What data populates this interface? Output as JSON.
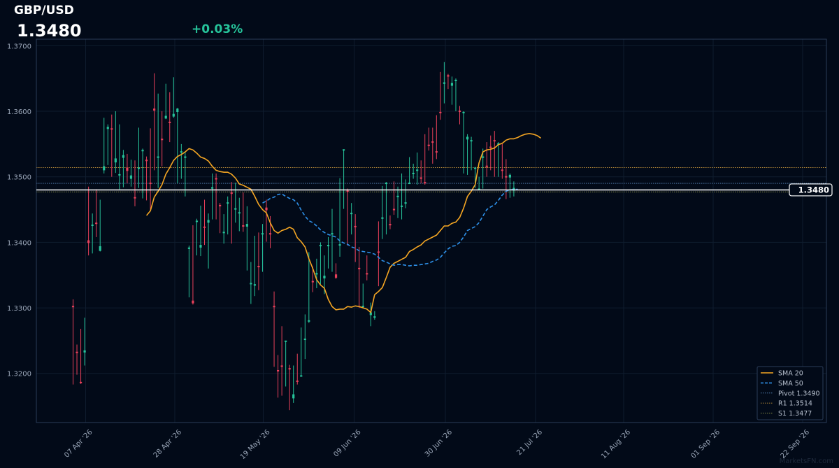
{
  "header": {
    "symbol": "GBP/USD",
    "price": "1.3480",
    "change": "+0.03%"
  },
  "watermark": "MarketsFN.com",
  "colors": {
    "background": "#020a18",
    "up": "#26c39a",
    "down": "#e8405a",
    "sma20": "#f5a623",
    "sma50": "#2e90e8",
    "pivot": "#5a8ac0",
    "r1": "#c9963a",
    "s1": "#9aa04a",
    "last_price_line": "#ffffff"
  },
  "chart_data": {
    "type": "candlestick",
    "title": "GBP/USD",
    "ylim": [
      1.3125,
      1.371
    ],
    "y_ticks": [
      "1.3200",
      "1.3300",
      "1.3400",
      "1.3500",
      "1.3600",
      "1.3700"
    ],
    "x_ticks": [
      "07 Apr '26",
      "28 Apr '26",
      "19 May '26",
      "09 Jun '26",
      "30 Jun '26",
      "21 Jul '26",
      "11 Aug '26",
      "01 Sep '26",
      "22 Sep '26"
    ],
    "last_price_label": "1.3480",
    "last_price": 1.348,
    "grid": true,
    "legend_position": "bottom-right",
    "legend": [
      "SMA 20",
      "SMA 50",
      "Pivot 1.3490",
      "R1 1.3514",
      "S1 1.3477"
    ],
    "levels": {
      "pivot": 1.349,
      "r1": 1.3514,
      "s1": 1.3477
    },
    "candles": [
      [
        1.3302,
        1.3302,
        1.3313,
        1.3183,
        "down"
      ],
      [
        1.3232,
        1.3232,
        1.3244,
        1.3198,
        "down"
      ],
      [
        1.3186,
        1.3186,
        1.3268,
        1.3184,
        "down"
      ],
      [
        1.3233,
        1.3234,
        1.3285,
        1.3212,
        "up"
      ],
      [
        1.3402,
        1.34,
        1.3485,
        1.338,
        "down"
      ],
      [
        1.3426,
        1.3426,
        1.3444,
        1.3383,
        "up"
      ],
      [
        1.3429,
        1.3429,
        1.3481,
        1.3408,
        "down"
      ],
      [
        1.3388,
        1.3393,
        1.3465,
        1.3386,
        "up"
      ],
      [
        1.3511,
        1.3515,
        1.359,
        1.3505,
        "up"
      ],
      [
        1.3574,
        1.3575,
        1.358,
        1.3518,
        "up"
      ],
      [
        1.3573,
        1.3573,
        1.3595,
        1.35,
        "down"
      ],
      [
        1.3523,
        1.3527,
        1.36,
        1.3506,
        "up"
      ],
      [
        1.3503,
        1.3503,
        1.358,
        1.3481,
        "up"
      ],
      [
        1.353,
        1.3532,
        1.3541,
        1.3484,
        "up"
      ],
      [
        1.3513,
        1.351,
        1.3535,
        1.349,
        "down"
      ],
      [
        1.3498,
        1.3501,
        1.3526,
        1.3485,
        "up"
      ],
      [
        1.3468,
        1.3468,
        1.3525,
        1.3455,
        "down"
      ],
      [
        1.3513,
        1.3513,
        1.3575,
        1.3483,
        "up"
      ],
      [
        1.354,
        1.354,
        1.3543,
        1.3467,
        "up"
      ],
      [
        1.3525,
        1.3525,
        1.3531,
        1.3464,
        "down"
      ],
      [
        1.349,
        1.349,
        1.3574,
        1.345,
        "down"
      ],
      [
        1.3603,
        1.3602,
        1.3658,
        1.351,
        "down"
      ],
      [
        1.353,
        1.353,
        1.3627,
        1.3483,
        "up"
      ],
      [
        1.3557,
        1.3557,
        1.36,
        1.3516,
        "down"
      ],
      [
        1.359,
        1.3592,
        1.3642,
        1.3588,
        "up"
      ],
      [
        1.3583,
        1.3583,
        1.3629,
        1.3553,
        "down"
      ],
      [
        1.3593,
        1.3595,
        1.3652,
        1.359,
        "up"
      ],
      [
        1.36,
        1.3603,
        1.3605,
        1.349,
        "up"
      ],
      [
        1.3538,
        1.3538,
        1.355,
        1.3497,
        "up"
      ],
      [
        1.353,
        1.353,
        1.3537,
        1.347,
        "up"
      ],
      [
        1.3391,
        1.3391,
        1.3395,
        1.3316,
        "up"
      ],
      [
        1.331,
        1.3308,
        1.3426,
        1.3305,
        "down"
      ],
      [
        1.3432,
        1.3432,
        1.3436,
        1.338,
        "up"
      ],
      [
        1.3393,
        1.3395,
        1.3456,
        1.3379,
        "up"
      ],
      [
        1.3423,
        1.3423,
        1.3465,
        1.3396,
        "down"
      ],
      [
        1.3431,
        1.3433,
        1.3444,
        1.336,
        "up"
      ],
      [
        1.3483,
        1.3483,
        1.3505,
        1.3435,
        "up"
      ],
      [
        1.3497,
        1.3497,
        1.3505,
        1.3435,
        "down"
      ],
      [
        1.3456,
        1.3456,
        1.346,
        1.3414,
        "down"
      ],
      [
        1.3415,
        1.3415,
        1.3443,
        1.3398,
        "up"
      ],
      [
        1.346,
        1.346,
        1.347,
        1.3412,
        "up"
      ],
      [
        1.3475,
        1.3475,
        1.3492,
        1.3398,
        "down"
      ],
      [
        1.3451,
        1.3451,
        1.3491,
        1.343,
        "up"
      ],
      [
        1.3445,
        1.3445,
        1.3468,
        1.3417,
        "up"
      ],
      [
        1.3425,
        1.3425,
        1.3476,
        1.3416,
        "down"
      ],
      [
        1.3425,
        1.3427,
        1.3455,
        1.3357,
        "up"
      ],
      [
        1.3337,
        1.3337,
        1.337,
        1.3306,
        "up"
      ],
      [
        1.3335,
        1.3335,
        1.341,
        1.3318,
        "up"
      ],
      [
        1.3363,
        1.3363,
        1.3415,
        1.3327,
        "down"
      ],
      [
        1.3413,
        1.3413,
        1.3428,
        1.3355,
        "up"
      ],
      [
        1.3452,
        1.345,
        1.3465,
        1.3401,
        "down"
      ],
      [
        1.3413,
        1.3413,
        1.344,
        1.3391,
        "down"
      ],
      [
        1.3302,
        1.3302,
        1.3325,
        1.321,
        "down"
      ],
      [
        1.3204,
        1.3204,
        1.3228,
        1.3163,
        "down"
      ],
      [
        1.3211,
        1.3211,
        1.3272,
        1.3166,
        "down"
      ],
      [
        1.3249,
        1.3249,
        1.325,
        1.318,
        "up"
      ],
      [
        1.3207,
        1.3207,
        1.3213,
        1.3144,
        "down"
      ],
      [
        1.3163,
        1.3167,
        1.3212,
        1.3155,
        "up"
      ],
      [
        1.3188,
        1.3188,
        1.323,
        1.3183,
        "down"
      ],
      [
        1.3196,
        1.3196,
        1.327,
        1.3195,
        "up"
      ],
      [
        1.3252,
        1.3252,
        1.329,
        1.3222,
        "up"
      ],
      [
        1.328,
        1.328,
        1.3385,
        1.3277,
        "up"
      ],
      [
        1.334,
        1.334,
        1.3363,
        1.3324,
        "down"
      ],
      [
        1.3352,
        1.3352,
        1.3375,
        1.333,
        "up"
      ],
      [
        1.3395,
        1.3395,
        1.34,
        1.3336,
        "up"
      ],
      [
        1.3346,
        1.3348,
        1.338,
        1.3321,
        "up"
      ],
      [
        1.3395,
        1.3395,
        1.3408,
        1.336,
        "up"
      ],
      [
        1.3413,
        1.3413,
        1.3451,
        1.3355,
        "up"
      ],
      [
        1.335,
        1.3347,
        1.3368,
        1.3344,
        "down"
      ],
      [
        1.3396,
        1.3396,
        1.3498,
        1.3378,
        "up"
      ],
      [
        1.3541,
        1.3541,
        1.3542,
        1.3451,
        "up"
      ],
      [
        1.3478,
        1.3478,
        1.3482,
        1.3395,
        "down"
      ],
      [
        1.3444,
        1.3444,
        1.346,
        1.3412,
        "up"
      ],
      [
        1.3424,
        1.3424,
        1.3443,
        1.337,
        "down"
      ],
      [
        1.336,
        1.336,
        1.3393,
        1.33,
        "down"
      ],
      [
        1.3302,
        1.3302,
        1.3337,
        1.33,
        "up"
      ],
      [
        1.3352,
        1.3352,
        1.338,
        1.3342,
        "down"
      ],
      [
        1.329,
        1.3292,
        1.3308,
        1.3272,
        "up"
      ],
      [
        1.3286,
        1.3286,
        1.3295,
        1.3282,
        "up"
      ],
      [
        1.3385,
        1.3385,
        1.3432,
        1.3333,
        "down"
      ],
      [
        1.3437,
        1.3437,
        1.3486,
        1.3405,
        "up"
      ],
      [
        1.349,
        1.349,
        1.3492,
        1.3412,
        "up"
      ],
      [
        1.3427,
        1.3427,
        1.3441,
        1.342,
        "down"
      ],
      [
        1.345,
        1.345,
        1.3493,
        1.3442,
        "down"
      ],
      [
        1.347,
        1.347,
        1.3485,
        1.3437,
        "up"
      ],
      [
        1.3455,
        1.3455,
        1.3505,
        1.3435,
        "up"
      ],
      [
        1.346,
        1.346,
        1.3496,
        1.3452,
        "up"
      ],
      [
        1.349,
        1.349,
        1.353,
        1.349,
        "up"
      ],
      [
        1.3505,
        1.3505,
        1.352,
        1.3497,
        "up"
      ],
      [
        1.351,
        1.351,
        1.3537,
        1.3488,
        "up"
      ],
      [
        1.3498,
        1.3498,
        1.3525,
        1.349,
        "down"
      ],
      [
        1.3491,
        1.3491,
        1.3565,
        1.3488,
        "down"
      ],
      [
        1.3548,
        1.3548,
        1.3575,
        1.354,
        "down"
      ],
      [
        1.3553,
        1.3553,
        1.3575,
        1.352,
        "down"
      ],
      [
        1.3538,
        1.3538,
        1.3594,
        1.3527,
        "down"
      ],
      [
        1.3598,
        1.3598,
        1.366,
        1.3587,
        "down"
      ],
      [
        1.3643,
        1.3643,
        1.3675,
        1.3612,
        "up"
      ],
      [
        1.3654,
        1.3654,
        1.3657,
        1.3634,
        "down"
      ],
      [
        1.364,
        1.3642,
        1.3653,
        1.361,
        "up"
      ],
      [
        1.3647,
        1.3647,
        1.365,
        1.36,
        "up"
      ],
      [
        1.36,
        1.36,
        1.3608,
        1.358,
        "down"
      ],
      [
        1.3598,
        1.3598,
        1.36,
        1.3505,
        "up"
      ],
      [
        1.3558,
        1.356,
        1.3565,
        1.3503,
        "up"
      ],
      [
        1.3555,
        1.3555,
        1.3561,
        1.351,
        "up"
      ],
      [
        1.3513,
        1.3513,
        1.3515,
        1.3483,
        "up"
      ],
      [
        1.3481,
        1.3481,
        1.35,
        1.348,
        "up"
      ],
      [
        1.353,
        1.353,
        1.3543,
        1.3482,
        "up"
      ],
      [
        1.3516,
        1.3516,
        1.3553,
        1.35,
        "down"
      ],
      [
        1.3545,
        1.3545,
        1.3563,
        1.351,
        "down"
      ],
      [
        1.3555,
        1.3555,
        1.357,
        1.35,
        "down"
      ],
      [
        1.355,
        1.355,
        1.3553,
        1.35,
        "up"
      ],
      [
        1.351,
        1.351,
        1.355,
        1.3497,
        "down"
      ],
      [
        1.35,
        1.35,
        1.3527,
        1.3466,
        "down"
      ],
      [
        1.35,
        1.3502,
        1.3505,
        1.3468,
        "up"
      ],
      [
        1.348,
        1.3482,
        1.3493,
        1.347,
        "up"
      ]
    ],
    "series": [
      {
        "name": "SMA 20",
        "start_index": 19,
        "values": [
          1.3441,
          1.3448,
          1.3469,
          1.3478,
          1.3488,
          1.3504,
          1.3514,
          1.3525,
          1.3531,
          1.3534,
          1.3538,
          1.3543,
          1.3541,
          1.3536,
          1.353,
          1.3528,
          1.3524,
          1.3516,
          1.351,
          1.3508,
          1.3507,
          1.3507,
          1.3504,
          1.3498,
          1.3489,
          1.3487,
          1.3484,
          1.3481,
          1.347,
          1.3458,
          1.345,
          1.3445,
          1.343,
          1.3418,
          1.3414,
          1.3418,
          1.342,
          1.3423,
          1.342,
          1.3407,
          1.3401,
          1.3393,
          1.3375,
          1.336,
          1.3343,
          1.3335,
          1.333,
          1.3313,
          1.3302,
          1.3297,
          1.3298,
          1.3298,
          1.3302,
          1.3301,
          1.3303,
          1.3302,
          1.33,
          1.3298,
          1.3293,
          1.332,
          1.3325,
          1.3331,
          1.3346,
          1.3362,
          1.3368,
          1.3371,
          1.3374,
          1.3377,
          1.3386,
          1.3389,
          1.3393,
          1.3396,
          1.3402,
          1.3405,
          1.3408,
          1.3411,
          1.3418,
          1.3425,
          1.3425,
          1.3429,
          1.3431,
          1.3438,
          1.3452,
          1.347,
          1.3478,
          1.3488,
          1.3521,
          1.3538,
          1.3541,
          1.3542,
          1.3544,
          1.3549,
          1.3551,
          1.3556,
          1.3558,
          1.3558,
          1.356,
          1.3563,
          1.3565,
          1.3566,
          1.3565,
          1.3563,
          1.3559
        ]
      },
      {
        "name": "SMA 50",
        "start_index": 49,
        "values": [
          1.346,
          1.3463,
          1.3467,
          1.3469,
          1.3473,
          1.3474,
          1.347,
          1.3467,
          1.3465,
          1.346,
          1.3449,
          1.344,
          1.3433,
          1.343,
          1.3425,
          1.3419,
          1.3415,
          1.3412,
          1.341,
          1.3408,
          1.3402,
          1.3399,
          1.3397,
          1.3393,
          1.3391,
          1.3387,
          1.3386,
          1.3385,
          1.3384,
          1.3382,
          1.3377,
          1.3372,
          1.337,
          1.3367,
          1.3365,
          1.3366,
          1.3366,
          1.3365,
          1.3364,
          1.3365,
          1.3365,
          1.3366,
          1.3367,
          1.3368,
          1.3371,
          1.3373,
          1.3377,
          1.3384,
          1.339,
          1.3394,
          1.3395,
          1.34,
          1.3408,
          1.3418,
          1.3421,
          1.3424,
          1.343,
          1.344,
          1.345,
          1.3454,
          1.3457,
          1.3464,
          1.3472,
          1.3478,
          1.348,
          1.3481,
          1.3481
        ]
      }
    ]
  }
}
